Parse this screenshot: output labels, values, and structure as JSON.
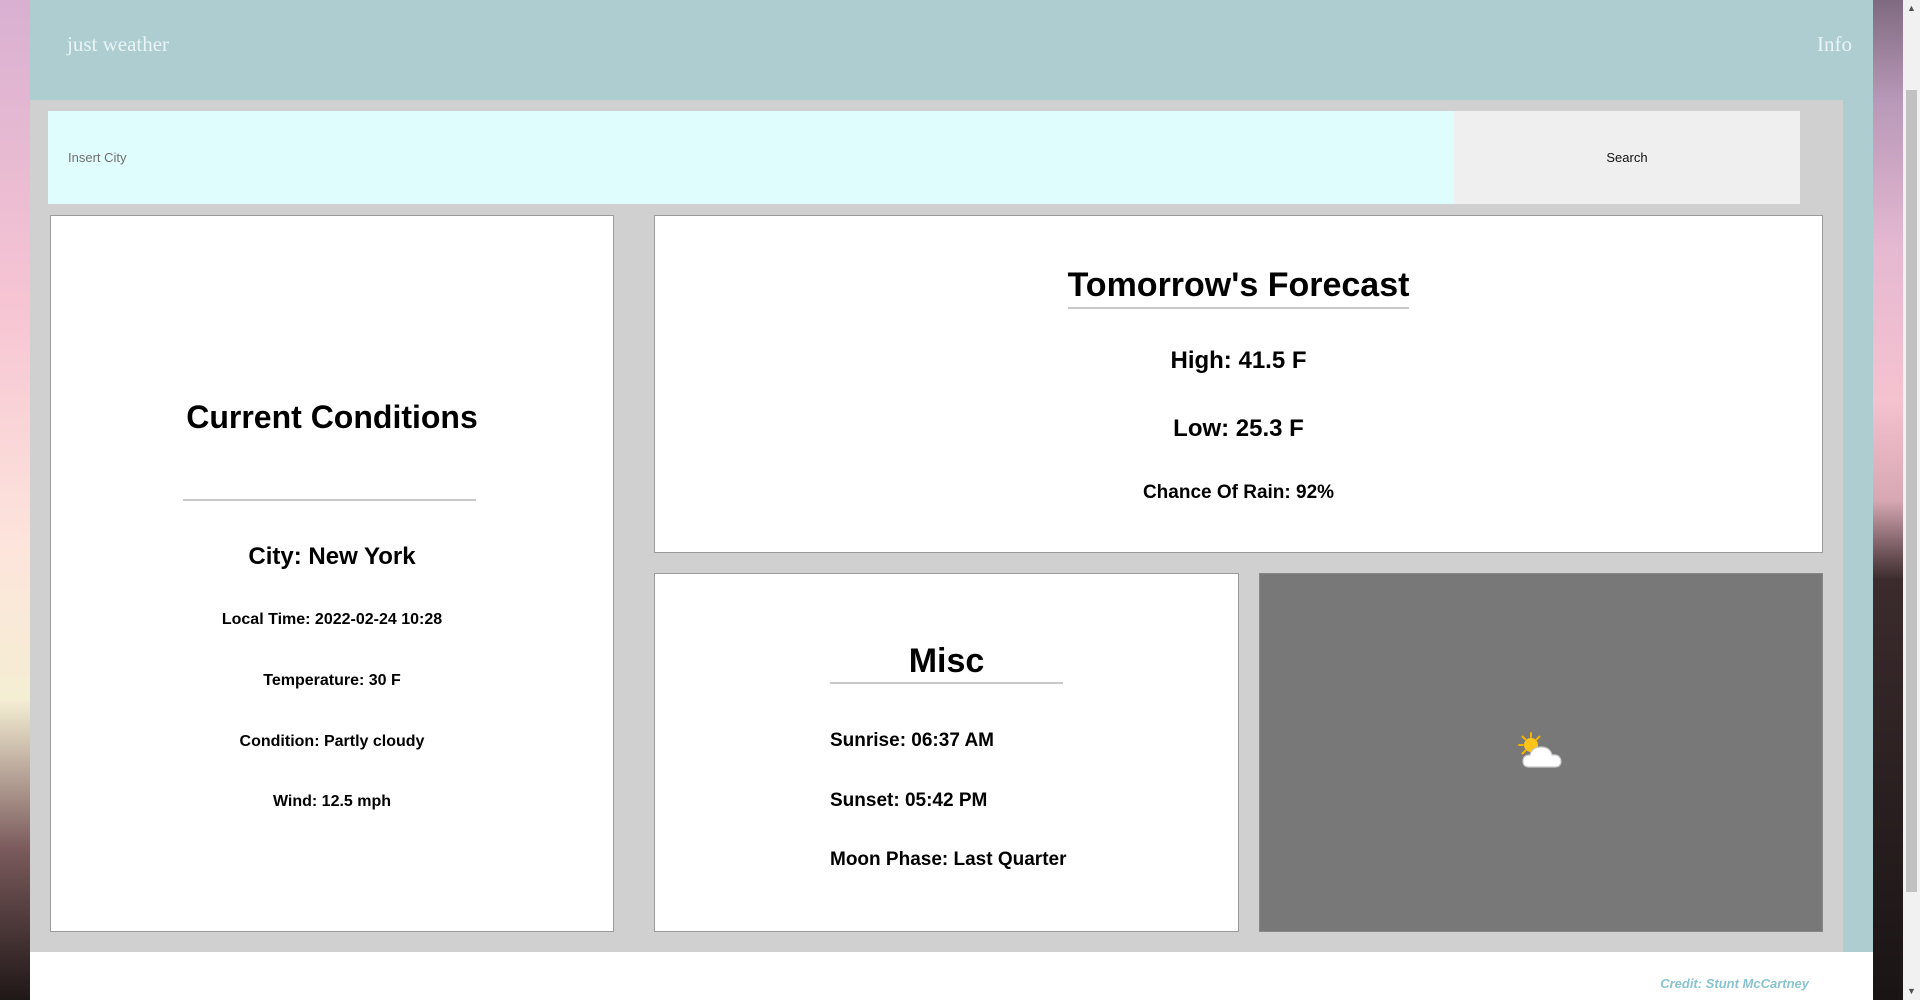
{
  "navbar": {
    "brand": "just weather",
    "info_link": "Info"
  },
  "search": {
    "placeholder": "Insert City",
    "value": "",
    "button_label": "Search"
  },
  "current_conditions": {
    "title": "Current Conditions",
    "city": "City: New York",
    "local_time": "Local Time: 2022-02-24 10:28",
    "temperature": "Temperature: 30 F",
    "condition": "Condition: Partly cloudy",
    "wind": "Wind: 12.5 mph"
  },
  "forecast": {
    "title": "Tomorrow's Forecast",
    "high": "High: 41.5 F",
    "low": "Low: 25.3 F",
    "chance_of_rain": "Chance Of Rain: 92%"
  },
  "misc": {
    "title": "Misc",
    "sunrise": "Sunrise: 06:37 AM",
    "sunset": "Sunset: 05:42 PM",
    "moon_phase": "Moon Phase: Last Quarter"
  },
  "weather_icon": {
    "icon": "partly-cloudy-icon"
  },
  "footer": {
    "credit": "Credit: Stunt McCartney"
  },
  "colors": {
    "navbar_bg": "#aecdd0",
    "search_input_bg": "#e0fdfe",
    "icon_panel_bg": "#787878",
    "credit_text": "#88c4cf"
  }
}
